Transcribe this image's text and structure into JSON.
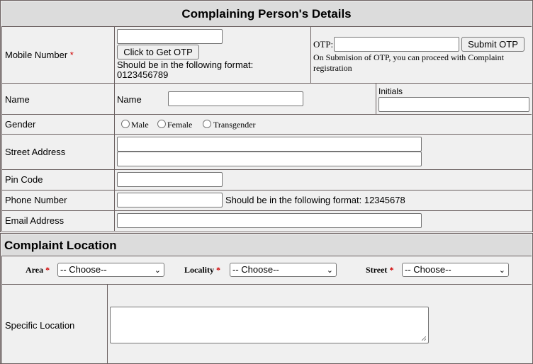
{
  "section1": {
    "title": "Complaining Person's Details",
    "mobile": {
      "label": "Mobile Number",
      "required": "*",
      "value": "",
      "otp_button": "Click to Get OTP",
      "format_hint_1": "Should be in the following format:",
      "format_hint_2": "0123456789"
    },
    "otp": {
      "label": "OTP:",
      "value": "",
      "submit": "Submit OTP",
      "note_1": "On Submision of OTP, you can proceed with Complaint",
      "note_2": "registration"
    },
    "name": {
      "label": "Name",
      "inner_label": "Name",
      "initials_label": "Initials"
    },
    "gender": {
      "label": "Gender",
      "options": [
        "Male",
        "Female",
        "Transgender"
      ]
    },
    "street": {
      "label": "Street Address"
    },
    "pin": {
      "label": "Pin Code"
    },
    "phone": {
      "label": "Phone Number",
      "format_hint": "Should be in the following format: 12345678"
    },
    "email": {
      "label": "Email Address"
    }
  },
  "section2": {
    "title": "Complaint Location",
    "area": {
      "label": "Area",
      "required": "*",
      "selected": "-- Choose--"
    },
    "locality": {
      "label": "Locality",
      "required": "*",
      "selected": "-- Choose--"
    },
    "street": {
      "label": "Street",
      "required": "*",
      "selected": "-- Choose--"
    },
    "specific_location": {
      "label": "Specific Location"
    }
  }
}
